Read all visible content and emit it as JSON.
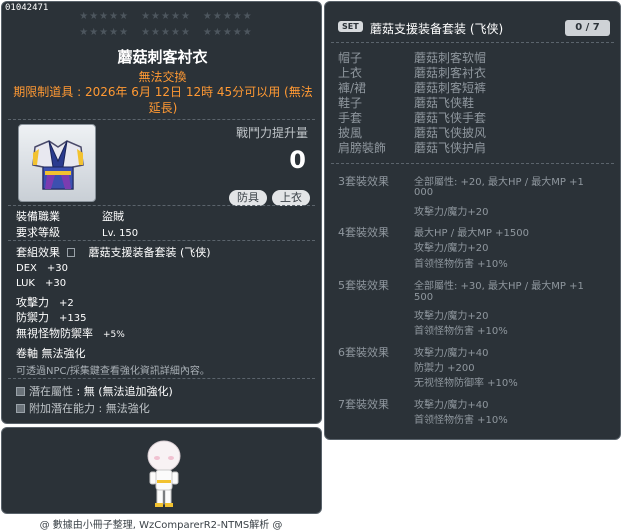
{
  "item": {
    "code": "01042471",
    "name": "蘑菇刺客衬衣",
    "untradeable": "無法交換",
    "expire_line1": "期限制道具 : 2026年 6月 12日 12時 45分可以用 (無法",
    "expire_line2": "延長)",
    "power_label": "戰鬥力提升量",
    "power_value": "0",
    "tags": [
      "防具",
      "上衣"
    ],
    "job_label": "裝備職業",
    "job_value": "盜賊",
    "level_label": "要求等級",
    "level_value": "Lv. 150",
    "set_label": "套組效果",
    "set_value": "蘑菇支援装备套装 (飞侠)",
    "stats": [
      {
        "label": "DEX",
        "value": "+30"
      },
      {
        "label": "LUK",
        "value": "+30"
      },
      {
        "label": "攻擊力",
        "value": "+2"
      },
      {
        "label": "防禦力",
        "value": "+135"
      },
      {
        "label": "無視怪物防禦率",
        "value": "+5%"
      }
    ],
    "scroll_label": "卷軸",
    "scroll_value": "無法強化",
    "hint": "可透過NPC/採集鍵查看強化資訊詳細內容。",
    "potential_label": "潛在屬性",
    "potential_value": ": 無 (無法追加強化)",
    "bonus_potential_label": "附加潛在能力",
    "bonus_potential_value": ": 無法強化",
    "icon": "mushroom-assassin-shirt-icon"
  },
  "set": {
    "badge": "SET",
    "name": "蘑菇支援装备套装 (飞侠)",
    "count": "0 / 7",
    "parts": [
      {
        "slot": "帽子",
        "item": "蘑菇刺客软帽"
      },
      {
        "slot": "上衣",
        "item": "蘑菇刺客衬衣"
      },
      {
        "slot": "褲/裙",
        "item": "蘑菇刺客短裤"
      },
      {
        "slot": "鞋子",
        "item": "蘑菇飞侠鞋"
      },
      {
        "slot": "手套",
        "item": "蘑菇飞侠手套"
      },
      {
        "slot": "披風",
        "item": "蘑菇飞侠披风"
      },
      {
        "slot": "肩膀裝飾",
        "item": "蘑菇飞侠护肩"
      }
    ],
    "bonuses": [
      {
        "label": "3套裝效果",
        "lines": [
          "全部屬性: +20, 最大HP / 最大MP  +1",
          "000",
          "攻擊力/魔力+20"
        ]
      },
      {
        "label": "4套裝效果",
        "lines": [
          "最大HP / 最大MP  +1500",
          "攻擊力/魔力+20",
          "首领怪物伤害  +10%"
        ]
      },
      {
        "label": "5套裝效果",
        "lines": [
          "全部屬性: +30, 最大HP / 最大MP  +1",
          "500",
          "攻擊力/魔力+20",
          "首领怪物伤害  +10%"
        ]
      },
      {
        "label": "6套裝效果",
        "lines": [
          "攻擊力/魔力+40",
          "防禦力  +200",
          "无视怪物防御率  +10%"
        ]
      },
      {
        "label": "7套裝效果",
        "lines": [
          "攻擊力/魔力+40",
          "首领怪物伤害  +10%"
        ]
      }
    ]
  },
  "footer": "@ 數據由小冊子整理, WzComparerR2-NTMS解析 @",
  "colors": {
    "panel_bg": "#2b3238",
    "orange": "#ff9933",
    "muted": "#8f979e"
  }
}
